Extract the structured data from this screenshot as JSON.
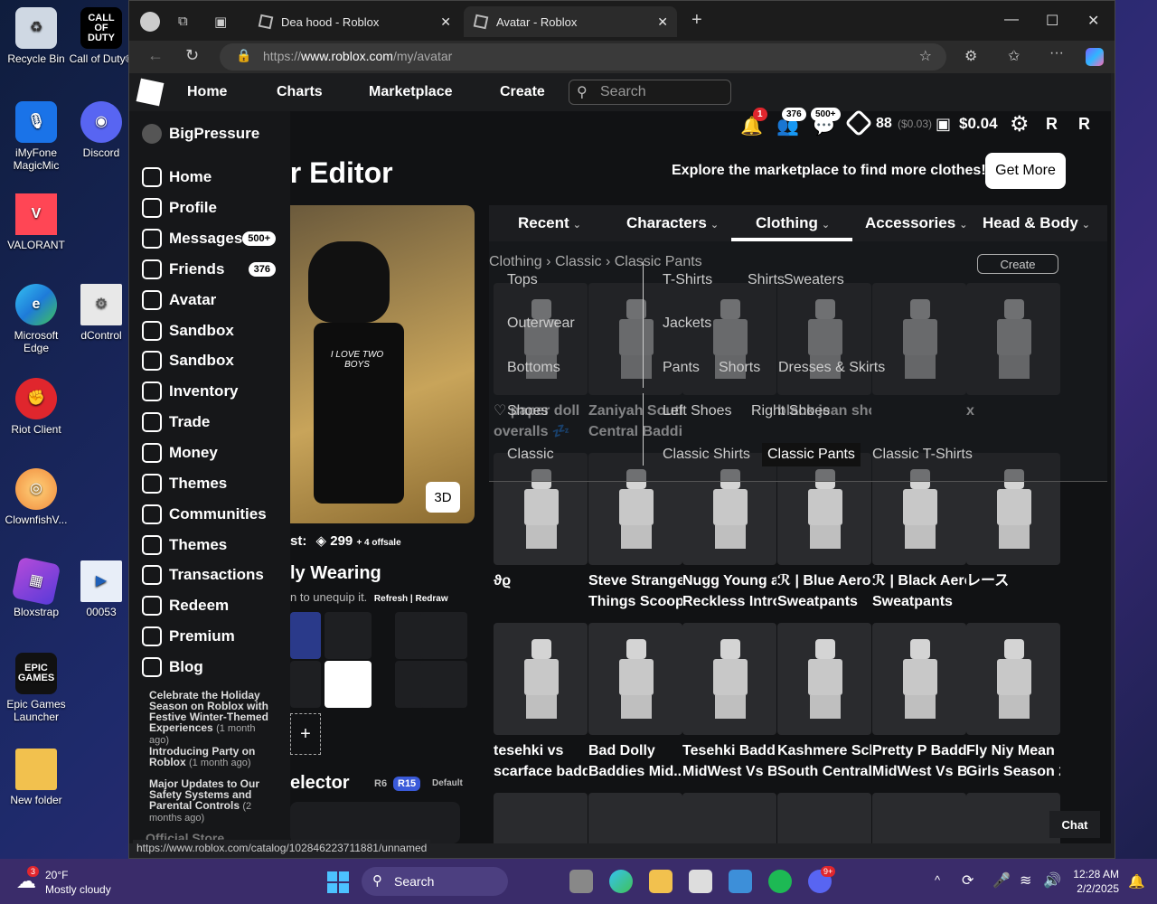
{
  "desktop": {
    "icons": [
      {
        "label": "Recycle Bin",
        "icon": "recycle-bin-icon"
      },
      {
        "label": "Call of Duty®",
        "icon": "call-of-duty-icon",
        "logo_text": "CALL OF DUTY"
      },
      {
        "label": "iMyFone MagicMic",
        "icon": "magicmic-icon"
      },
      {
        "label": "Discord",
        "icon": "discord-icon"
      },
      {
        "label": "VALORANT",
        "icon": "valorant-icon"
      },
      {
        "label": "Microsoft Edge",
        "icon": "edge-icon"
      },
      {
        "label": "dControl",
        "icon": "dcontrol-icon"
      },
      {
        "label": "Riot Client",
        "icon": "riot-icon"
      },
      {
        "label": "ClownfishV...",
        "icon": "clownfish-icon"
      },
      {
        "label": "Bloxstrap",
        "icon": "bloxstrap-icon"
      },
      {
        "label": "00053",
        "icon": "video-file-icon"
      },
      {
        "label": "Epic Games Launcher",
        "icon": "epic-games-icon",
        "logo_text": "EPIC GAMES"
      },
      {
        "label": "New folder",
        "icon": "folder-icon"
      }
    ]
  },
  "browser": {
    "tabs": [
      {
        "title": "Dea hood - Roblox"
      },
      {
        "title": "Avatar - Roblox"
      }
    ],
    "url_prefix": "https://",
    "url_domain": "www.roblox.com",
    "url_path": "/my/avatar",
    "status_url": "https://www.roblox.com/catalog/102846223711881/unnamed"
  },
  "topnav": {
    "links": [
      "Home",
      "Charts",
      "Marketplace",
      "Create"
    ],
    "search_placeholder": "Search",
    "notifications": "1",
    "friends_count": "376",
    "messages_count": "500+",
    "robux": "88",
    "robux_usd": "($0.03)",
    "wallet": "$0.04"
  },
  "sidebar": {
    "username": "BigPressure",
    "items": [
      {
        "label": "Home"
      },
      {
        "label": "Profile"
      },
      {
        "label": "Messages",
        "count": "500+"
      },
      {
        "label": "Friends",
        "count": "376"
      },
      {
        "label": "Avatar"
      },
      {
        "label": "Sandbox"
      },
      {
        "label": "Sandbox"
      },
      {
        "label": "Inventory"
      },
      {
        "label": "Trade"
      },
      {
        "label": "Money"
      },
      {
        "label": "Themes"
      },
      {
        "label": "Communities"
      },
      {
        "label": "Themes"
      },
      {
        "label": "Transactions"
      },
      {
        "label": "Redeem"
      },
      {
        "label": "Premium"
      },
      {
        "label": "Blog"
      }
    ],
    "blog": [
      {
        "title": "Celebrate the Holiday Season on Roblox with Festive Winter-Themed Experiences",
        "age": "(1 month ago)"
      },
      {
        "title": "Introducing Party on Roblox",
        "age": "(1 month ago)"
      },
      {
        "title": "Major Updates to Our Safety Systems and Parental Controls",
        "age": "(2 months ago)"
      }
    ],
    "official_store": "Official Store"
  },
  "main": {
    "title": "ar Editor",
    "explore_text": "Explore the marketplace to find more clothes!",
    "get_more": "Get More",
    "btn_3d": "3D",
    "cost_prefix": "st:",
    "cost_value": "299",
    "cost_offsale": "+ 4 offsale",
    "wearing_title": "ly Wearing",
    "wearing_hint": "n to unequip it.",
    "refresh_redraw": "Refresh | Redraw",
    "add_symbol": "+",
    "selector_title": "elector",
    "selector_options": [
      "R6",
      "R15",
      "Default"
    ],
    "avatar_shirt_text": "I LOVE TWO BOYS"
  },
  "categories": {
    "tabs": [
      "Recent",
      "Characters",
      "Clothing",
      "Accessories",
      "Head & Body"
    ],
    "active": "Clothing"
  },
  "breadcrumb": {
    "parts": [
      "Clothing",
      "Classic",
      "Classic Pants"
    ],
    "sep": "›"
  },
  "create_label": "Create",
  "dropdown": {
    "groups": [
      {
        "label": "Tops",
        "options": [
          "T-Shirts",
          "Shirts",
          "Sweaters"
        ]
      },
      {
        "label": "Outerwear",
        "options": [
          "Jackets"
        ]
      },
      {
        "label": "Bottoms",
        "options": [
          "Pants",
          "Shorts",
          "Dresses & Skirts"
        ]
      },
      {
        "label": "Shoes",
        "options": [
          "Left Shoes",
          "Right Shoes"
        ]
      },
      {
        "label": "Classic",
        "options": [
          "Classic Shirts",
          "Classic Pants",
          "Classic T-Shirts"
        ]
      }
    ],
    "selected": "Classic Pants"
  },
  "items_row1": [
    {
      "name1": "♡ paper doll",
      "name2": "overalls 💤"
    },
    {
      "name1": "Zaniyah South",
      "name2": "Central Baddies..."
    },
    {
      "name1": "",
      "name2": ""
    },
    {
      "name1": "black jean shorts",
      "name2": ""
    },
    {
      "name1": "",
      "name2": ""
    },
    {
      "name1": "x",
      "name2": ""
    }
  ],
  "items_row2": [
    {
      "name1": "ϑϱ",
      "name2": ""
    },
    {
      "name1": "Steve Stranger",
      "name2": "Things Scoops..."
    },
    {
      "name1": "Nugg Young and",
      "name2": "Reckless Intro..."
    },
    {
      "name1": "ℛ | Blue Aero",
      "name2": "Sweatpants"
    },
    {
      "name1": "ℛ | Black Aero",
      "name2": "Sweatpants"
    },
    {
      "name1": "レース",
      "name2": ""
    }
  ],
  "items_row3": [
    {
      "name1": "tesehki vs",
      "name2": "scarface badd..."
    },
    {
      "name1": "Bad Dolly",
      "name2": "Baddies Mid..."
    },
    {
      "name1": "Tesehki Baddies",
      "name2": "MidWest Vs Ba..."
    },
    {
      "name1": "Kashmere Scb",
      "name2": "South Central..."
    },
    {
      "name1": "Pretty P Baddies",
      "name2": "MidWest Vs Ba..."
    },
    {
      "name1": "Fly Niy Mean",
      "name2": "Girls Season 2"
    }
  ],
  "chat_label": "Chat",
  "taskbar": {
    "weather_temp": "20°F",
    "weather_desc": "Mostly cloudy",
    "weather_alert": "3",
    "search_label": "Search",
    "discord_badge": "9+",
    "time": "12:28 AM",
    "date": "2/2/2025"
  },
  "colors": {
    "r15_badge": "#3a5ad9",
    "page_bg": "#111214",
    "taskbar": "#3a2c6a"
  }
}
